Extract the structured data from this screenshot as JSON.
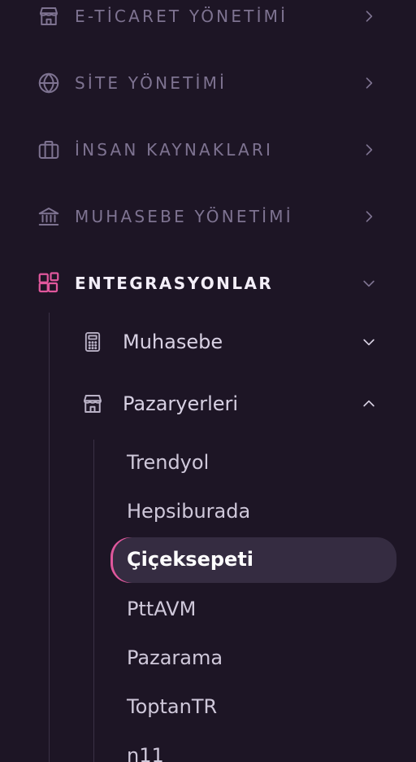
{
  "sections": [
    {
      "label": "E-TİCARET YÖNETİMİ",
      "icon": "store-icon",
      "chevron": "chevron-right-icon"
    },
    {
      "label": "SİTE YÖNETİMİ",
      "icon": "globe-icon",
      "chevron": "chevron-right-icon"
    },
    {
      "label": "İNSAN KAYNAKLARI",
      "icon": "briefcase-icon",
      "chevron": "chevron-right-icon"
    },
    {
      "label": "MUHASEBE YÖNETİMİ",
      "icon": "bank-icon",
      "chevron": "chevron-right-icon"
    },
    {
      "label": "ENTEGRASYONLAR",
      "icon": "grid-plus-icon",
      "chevron": "chevron-down-icon",
      "active": true
    }
  ],
  "groups": [
    {
      "label": "Muhasebe",
      "icon": "calculator-icon",
      "chevron": "chevron-down-icon"
    },
    {
      "label": "Pazaryerleri",
      "icon": "store-icon",
      "chevron": "chevron-up-icon",
      "expanded": true
    }
  ],
  "marketplaces": [
    {
      "label": "Trendyol"
    },
    {
      "label": "Hepsiburada"
    },
    {
      "label": "Çiçeksepeti",
      "active": true
    },
    {
      "label": "PttAVM"
    },
    {
      "label": "Pazarama"
    },
    {
      "label": "ToptanTR"
    },
    {
      "label": "n11"
    }
  ],
  "colors": {
    "background": "#1d1525",
    "muted": "#7e7391",
    "accent": "#e0579c",
    "active_bg": "#352c41",
    "text": "#d8d1e3"
  }
}
